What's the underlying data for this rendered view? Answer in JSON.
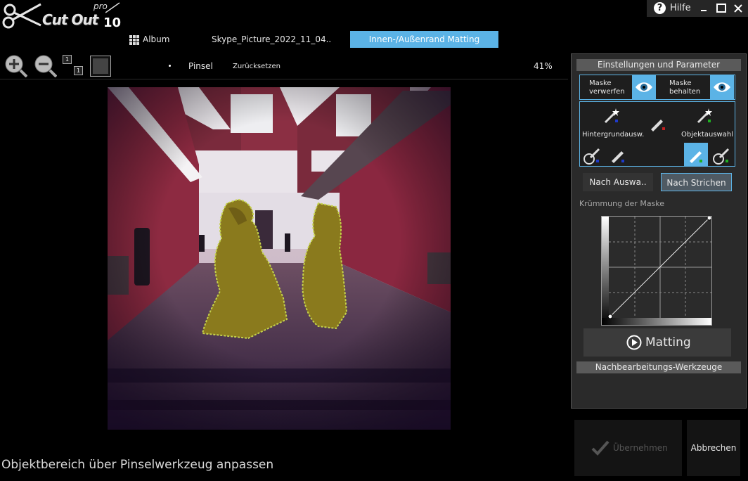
{
  "app": {
    "logo_name": "Cut Out",
    "logo_pro": "pro",
    "logo_version": "10"
  },
  "window": {
    "help_label": "Hilfe",
    "help_icon": "?",
    "minimize_icon": "minimize-icon",
    "maximize_icon": "maximize-icon",
    "close_icon": "close-icon"
  },
  "tabs": {
    "album_label": "Album",
    "file_tab_label": "Skype_Picture_2022_11_04..",
    "active_tab_label": "Innen-/Außenrand Matting"
  },
  "toolbar": {
    "zoom_in_icon": "zoom-in-icon",
    "zoom_out_icon": "zoom-out-icon",
    "actual_size_label": "1",
    "brush_label": "Pinsel",
    "reset_label": "Zurücksetzen",
    "zoom_value": "41%"
  },
  "status_text": "Objektbereich über Pinselwerkzeug anpassen",
  "panel": {
    "settings_header": "Einstellungen und Parameter",
    "discard_mask_label_1": "Maske",
    "discard_mask_label_2": "verwerfen",
    "keep_mask_label_1": "Maske",
    "keep_mask_label_2": "behalten",
    "background_select_label": "Hintergrundausw.",
    "object_select_label": "Objektauswahl",
    "by_selection_label": "Nach Auswa..",
    "by_strokes_label": "Nach Strichen",
    "curve_label": "Krümmung der Maske",
    "matting_label": "Matting",
    "post_tools_header": "Nachbearbeitungs-Werkzeuge",
    "accent_color": "#5bb3e6"
  },
  "footer": {
    "accept_label": "Übernehmen",
    "cancel_label": "Abbrechen"
  }
}
